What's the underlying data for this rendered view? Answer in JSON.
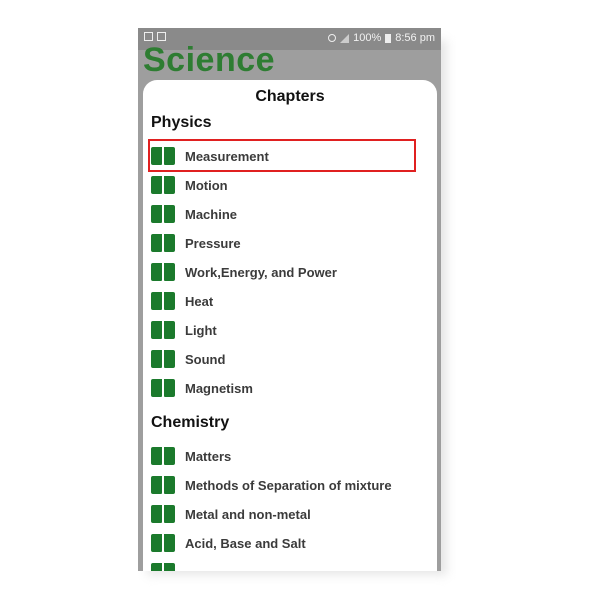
{
  "status_bar": {
    "battery": "100%",
    "time": "8:56 pm"
  },
  "app": {
    "title": "Science"
  },
  "panel": {
    "title": "Chapters"
  },
  "sections": [
    {
      "title": "Physics",
      "chapters": [
        "Measurement",
        "Motion",
        "Machine",
        "Pressure",
        "Work,Energy, and Power",
        "Heat",
        "Light",
        "Sound",
        "Magnetism"
      ]
    },
    {
      "title": "Chemistry",
      "chapters": [
        "Matters",
        "Methods of Separation of mixture",
        "Metal and non-metal",
        "Acid, Base and Salt"
      ]
    }
  ],
  "colors": {
    "accent": "#2e7d32",
    "book_icon": "#1b7a2c",
    "highlight": "#e02020"
  },
  "icons": {
    "chapter": "book-icon"
  }
}
